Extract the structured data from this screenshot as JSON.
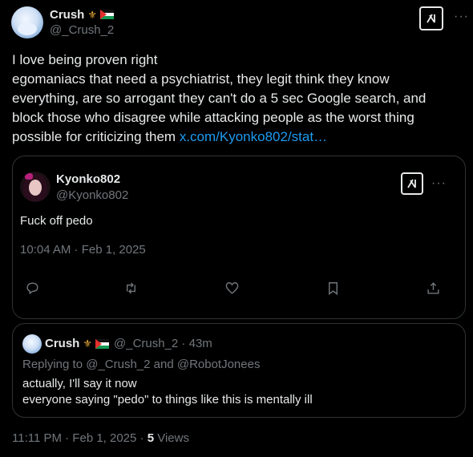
{
  "tweet": {
    "author": {
      "display_name": "Crush",
      "handle": "@_Crush_2",
      "badges": [
        "crown-emoji",
        "palestine-flag-emoji"
      ]
    },
    "text_lines": [
      "I love being proven right",
      "egomaniacs that need a psychiatrist, they legit think they know",
      "everything, are so arrogant they can't do a 5 sec Google search, and",
      "block those who disagree while attacking people as the worst thing",
      "possible for criticizing them"
    ],
    "link_text": "x.com/Kyonko802/stat…",
    "grok_icon": "grok-icon",
    "more_icon": "more-icon",
    "footer": {
      "time": "11:11 PM · Feb 1, 2025 · ",
      "views_count": "5",
      "views_label": " Views"
    }
  },
  "quoted_tweet": {
    "display_name": "Kyonko802",
    "handle": "@Kyonko802",
    "text": "Fuck off pedo",
    "timestamp": "10:04 AM · Feb 1, 2025",
    "actions": [
      "reply-icon",
      "retweet-icon",
      "like-icon",
      "bookmark-icon",
      "share-icon"
    ]
  },
  "reply": {
    "display_name": "Crush",
    "handle_time": "@_Crush_2 · 43m",
    "replying_to": "Replying to @_Crush_2 and @RobotJonees",
    "text_lines": [
      "actually, I'll say it now",
      "everyone saying \"pedo\" to things like this is mentally ill"
    ]
  },
  "colors": {
    "background": "#000000",
    "text": "#e7e9ea",
    "muted": "#71767b",
    "link": "#1d9bf0",
    "border": "#2f3336"
  }
}
